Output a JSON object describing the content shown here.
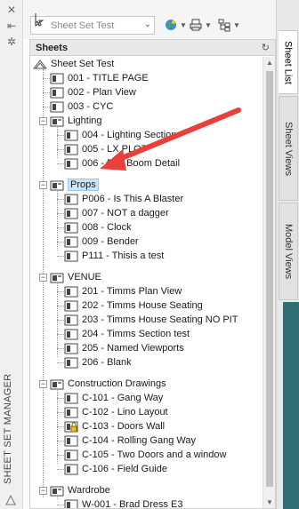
{
  "palette": {
    "title": "SHEET SET MANAGER",
    "close_glyph": "✕",
    "pin_glyph": "⇤",
    "props_glyph": "✲"
  },
  "header": {
    "sheet_set_select": {
      "value": "Sheet Set Test",
      "arrow": "⌄"
    }
  },
  "panel": {
    "title": "Sheets",
    "refresh_glyph": "↻"
  },
  "tree": {
    "root": "Sheet Set Test",
    "expander_minus": "−",
    "items": [
      {
        "label": "001 - TITLE PAGE"
      },
      {
        "label": "002 - Plan View"
      },
      {
        "label": "003 - CYC"
      },
      {
        "label": "Lighting"
      },
      {
        "label": "004 - Lighting Section"
      },
      {
        "label": "005 - LX PLOT"
      },
      {
        "label": "006 - Box Boom Detail"
      },
      {
        "label": "Props"
      },
      {
        "label": "P006 - Is This A Blaster"
      },
      {
        "label": "007 - NOT a dagger"
      },
      {
        "label": "008 - Clock"
      },
      {
        "label": "009 - Bender"
      },
      {
        "label": "P111 - Thisis a test"
      },
      {
        "label": "VENUE"
      },
      {
        "label": "201 - Timms Plan View"
      },
      {
        "label": "202 - Timms House Seating"
      },
      {
        "label": "203 - Timms House Seating NO PIT"
      },
      {
        "label": "204 - Timms Section test"
      },
      {
        "label": "205 - Named Viewports"
      },
      {
        "label": "206 - Blank"
      },
      {
        "label": "Construction Drawings"
      },
      {
        "label": "C-101 - Gang Way"
      },
      {
        "label": "C-102 - Lino Layout"
      },
      {
        "label": "C-103 - Doors Wall"
      },
      {
        "label": "C-104 - Rolling Gang Way"
      },
      {
        "label": "C-105 - Two Doors and a window"
      },
      {
        "label": "C-106 - Field Guide"
      },
      {
        "label": "Wardrobe"
      },
      {
        "label": "W-001 - Brad Dress E3"
      }
    ]
  },
  "scrollbar": {
    "up": "▲",
    "down": "▼"
  },
  "tabs": {
    "sheet_list": "Sheet List",
    "sheet_views": "Sheet Views",
    "model_views": "Model Views"
  },
  "colors": {
    "selection": "#cde4f7",
    "annotation_arrow": "#e8403a",
    "accent_teal": "#2e6e73"
  },
  "icons": {
    "sheet": "sheet-icon",
    "subset": "subset-folder-icon",
    "sheet_set": "sheet-set-icon"
  }
}
